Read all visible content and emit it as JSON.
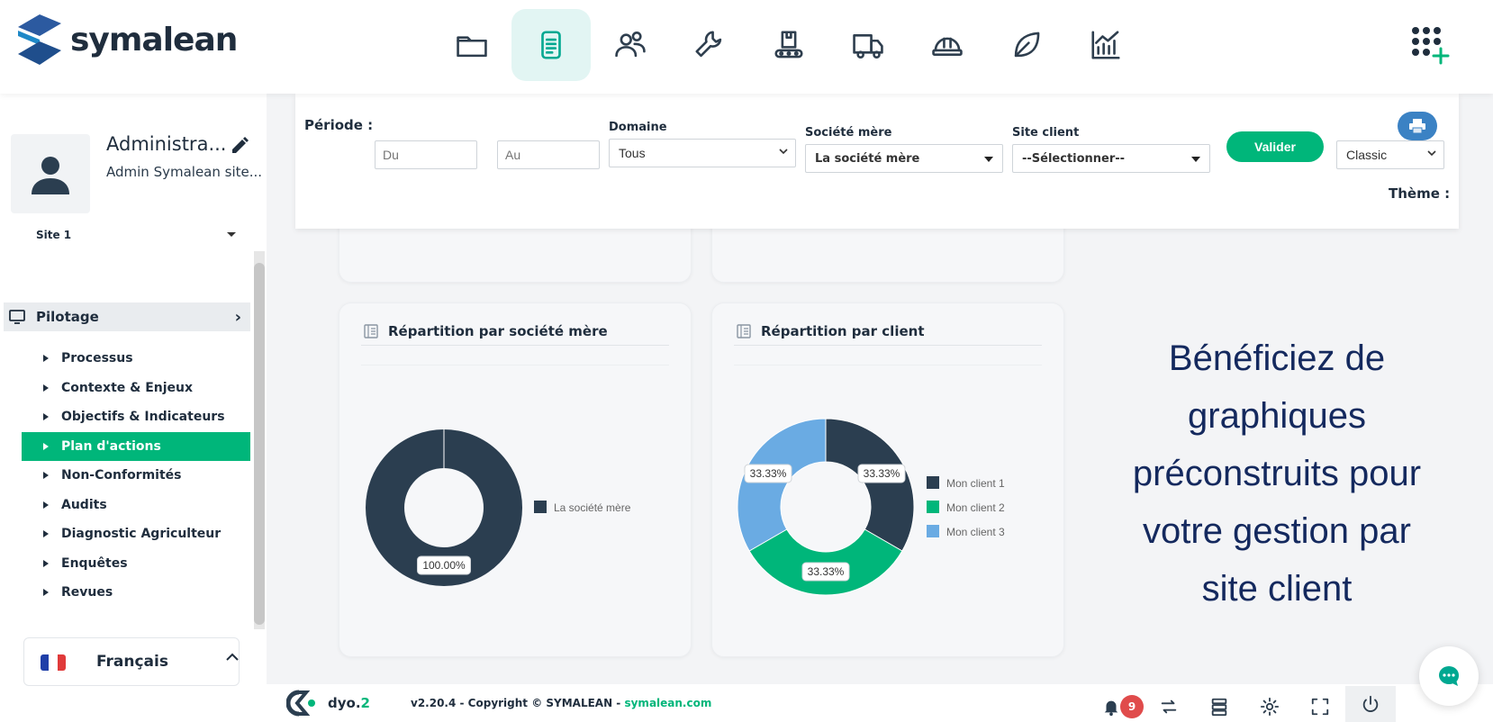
{
  "app": {
    "brand": "symalean"
  },
  "colors": {
    "accent": "#00b67a",
    "navy": "#2b3e50",
    "blue": "#6aabe3",
    "promo": "#14295e"
  },
  "nav": {
    "items": [
      {
        "icon": "folder-icon",
        "active": false
      },
      {
        "icon": "document-icon",
        "active": true
      },
      {
        "icon": "users-icon",
        "active": false
      },
      {
        "icon": "wrench-icon",
        "active": false
      },
      {
        "icon": "conveyor-icon",
        "active": false
      },
      {
        "icon": "truck-icon",
        "active": false
      },
      {
        "icon": "hard-hat-icon",
        "active": false
      },
      {
        "icon": "leaf-icon",
        "active": false
      },
      {
        "icon": "chart-icon",
        "active": false
      }
    ],
    "apps_icon": "apps-plus-icon"
  },
  "user": {
    "name": "Administra...",
    "subtitle": "Admin Symalean site..."
  },
  "site": {
    "selected": "Site 1"
  },
  "sidebar": {
    "section": "Pilotage",
    "items": [
      {
        "label": "Processus",
        "active": false
      },
      {
        "label": "Contexte & Enjeux",
        "active": false
      },
      {
        "label": "Objectifs & Indicateurs",
        "active": false
      },
      {
        "label": "Plan d'actions",
        "active": true
      },
      {
        "label": "Non-Conformités",
        "active": false
      },
      {
        "label": "Audits",
        "active": false
      },
      {
        "label": "Diagnostic Agriculteur",
        "active": false
      },
      {
        "label": "Enquêtes",
        "active": false
      },
      {
        "label": "Revues",
        "active": false
      }
    ],
    "language": "Français"
  },
  "filters": {
    "periode_label": "Période :",
    "du_placeholder": "Du",
    "au_placeholder": "Au",
    "domaine_label": "Domaine",
    "domaine_value": "Tous",
    "societe_label": "Société mère",
    "societe_value": "La société mère",
    "site_client_label": "Site client",
    "site_client_value": "--Sélectionner--",
    "valider_label": "Valider",
    "theme_value": "Classic",
    "theme_label": "Thème :"
  },
  "cards": {
    "societe_title": "Répartition par société mère",
    "client_title": "Répartition par client"
  },
  "chart_data": [
    {
      "type": "pie",
      "title": "Répartition par société mère",
      "categories": [
        "La société mère"
      ],
      "values": [
        100
      ],
      "data_labels": [
        "100.00%"
      ],
      "colors": [
        "#2b3e50"
      ],
      "legend": "right"
    },
    {
      "type": "pie",
      "title": "Répartition par client",
      "categories": [
        "Mon client 1",
        "Mon client 2",
        "Mon client 3"
      ],
      "values": [
        33.33,
        33.33,
        33.33
      ],
      "data_labels": [
        "33.33%",
        "33.33%",
        "33.33%"
      ],
      "colors": [
        "#2b3e50",
        "#00b67a",
        "#6aabe3"
      ],
      "legend": "right"
    }
  ],
  "promo": {
    "lines": [
      "Bénéficiez de",
      "graphiques",
      "préconstruits pour",
      "votre gestion par",
      "site client"
    ]
  },
  "footer": {
    "brand": "dyo.",
    "brand_suffix": "2",
    "copyright": "v2.20.4 - Copyright © SYMALEAN - ",
    "link": "symalean.com",
    "notification_count": "9"
  }
}
